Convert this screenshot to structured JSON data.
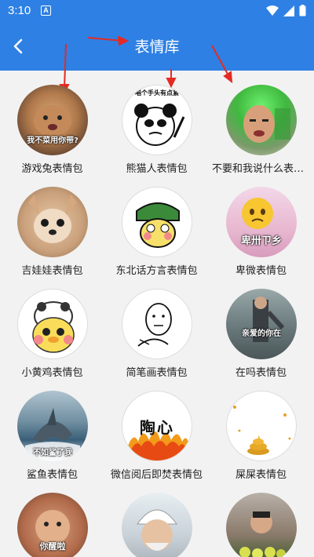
{
  "status_bar": {
    "time": "3:10",
    "app_badge": "A"
  },
  "header": {
    "title": "表情库"
  },
  "stickers": [
    {
      "label": "游戏兔表情包",
      "caption": "我不菜用你带?"
    },
    {
      "label": "熊猫人表情包",
      "caption": "唱个手头有点紧"
    },
    {
      "label": "不要和我说什么表情包",
      "caption": ""
    },
    {
      "label": "吉娃娃表情包",
      "caption": ""
    },
    {
      "label": "东北话方言表情包",
      "caption": ""
    },
    {
      "label": "卑微表情包",
      "caption": "卑卅ㄗ乡"
    },
    {
      "label": "小黄鸡表情包",
      "caption": ""
    },
    {
      "label": "简笔画表情包",
      "caption": ""
    },
    {
      "label": "在吗表情包",
      "caption": "亲爱的你在"
    },
    {
      "label": "鲨鱼表情包",
      "caption": "不如鲨了我"
    },
    {
      "label": "微信阅后即焚表情包",
      "caption": "陶心"
    },
    {
      "label": "屎屎表情包",
      "caption": ""
    },
    {
      "label": "",
      "caption": "你醒啦"
    },
    {
      "label": "",
      "caption": ""
    },
    {
      "label": "",
      "caption": ""
    }
  ]
}
